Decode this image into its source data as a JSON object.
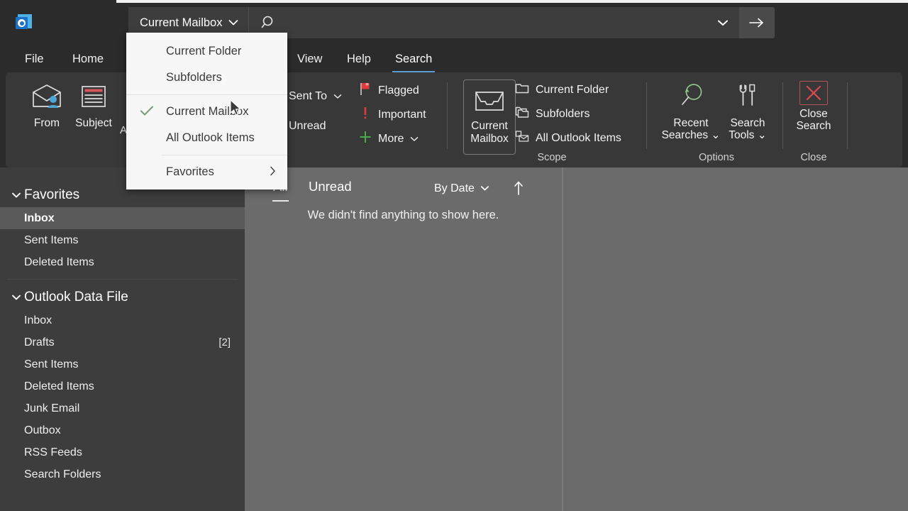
{
  "app": {
    "name": "Microsoft Outlook",
    "logo_icon": "outlook-logo-icon"
  },
  "search": {
    "scope_label": "Current Mailbox",
    "scope_chevron_icon": "chevron-down-icon",
    "search_icon": "magnifier-icon",
    "input_value": "",
    "input_placeholder": "",
    "expand_icon": "chevron-down-icon",
    "submit_icon": "arrow-right-icon"
  },
  "ribbon_tabs": [
    {
      "label": "File",
      "active": false
    },
    {
      "label": "Home",
      "active": false
    },
    {
      "label": "View",
      "active": false
    },
    {
      "label": "Help",
      "active": false
    },
    {
      "label": "Search",
      "active": true
    }
  ],
  "ribbon": {
    "scope_group_label": "Scope",
    "options_group_label": "Options",
    "close_group_label": "Close",
    "refine_buttons": [
      {
        "label": "From",
        "icon": "envelope-person-icon"
      },
      {
        "label": "Subject",
        "icon": "subject-lines-icon"
      }
    ],
    "partial_label": "At",
    "refine_small": [
      {
        "label": "Sent To",
        "has_chevron": true,
        "icon": "chevron-down-icon"
      },
      {
        "label": "Unread",
        "has_chevron": false,
        "icon": ""
      }
    ],
    "flag_items": [
      {
        "label": "Flagged",
        "icon": "red-flag-icon",
        "color": "#e03a3a"
      },
      {
        "label": "Important",
        "icon": "exclamation-icon",
        "color": "#e03a3a"
      },
      {
        "label": "More",
        "icon": "green-plus-icon",
        "color": "#4caf50",
        "has_chevron": true
      }
    ],
    "scope_primary": {
      "label_line1": "Current",
      "label_line2": "Mailbox",
      "icon": "mailbox-tray-icon",
      "selected": true
    },
    "scope_items": [
      {
        "label": "Current Folder",
        "icon": "folder-icon"
      },
      {
        "label": "Subfolders",
        "icon": "folders-stacked-icon"
      },
      {
        "label": "All Outlook Items",
        "icon": "all-items-icon"
      }
    ],
    "options_buttons": [
      {
        "label_line1": "Recent",
        "label_line2": "Searches",
        "icon": "recent-search-icon",
        "has_chevron": true
      },
      {
        "label_line1": "Search",
        "label_line2": "Tools",
        "icon": "wrench-screwdriver-icon",
        "has_chevron": true
      }
    ],
    "close_button": {
      "label_line1": "Close",
      "label_line2": "Search",
      "icon": "red-x-icon",
      "color": "#d94a52"
    }
  },
  "scope_menu": {
    "open": true,
    "items": [
      {
        "label": "Current Folder",
        "checked": false,
        "submenu": false
      },
      {
        "label": "Subfolders",
        "checked": false,
        "submenu": false
      },
      {
        "label": "Current Mailbox",
        "checked": true,
        "submenu": false
      },
      {
        "label": "All Outlook Items",
        "checked": false,
        "submenu": false
      },
      {
        "label": "Favorites",
        "checked": false,
        "submenu": true
      }
    ],
    "check_icon": "checkmark-icon",
    "submenu_icon": "chevron-right-icon"
  },
  "sidebar": {
    "collapse_icon": "chevron-left-icon",
    "groups": [
      {
        "title": "Favorites",
        "chevron_icon": "chevron-down-icon",
        "items": [
          {
            "label": "Inbox",
            "count": "",
            "selected": true
          },
          {
            "label": "Sent Items",
            "count": "",
            "selected": false
          },
          {
            "label": "Deleted Items",
            "count": "",
            "selected": false
          }
        ]
      },
      {
        "title": "Outlook Data File",
        "chevron_icon": "chevron-down-icon",
        "items": [
          {
            "label": "Inbox",
            "count": "",
            "selected": false
          },
          {
            "label": "Drafts",
            "count": "[2]",
            "selected": false
          },
          {
            "label": "Sent Items",
            "count": "",
            "selected": false
          },
          {
            "label": "Deleted Items",
            "count": "",
            "selected": false
          },
          {
            "label": "Junk Email",
            "count": "",
            "selected": false
          },
          {
            "label": "Outbox",
            "count": "",
            "selected": false
          },
          {
            "label": "RSS Feeds",
            "count": "",
            "selected": false
          },
          {
            "label": "Search Folders",
            "count": "",
            "selected": false
          }
        ]
      }
    ]
  },
  "message_list": {
    "filters": [
      {
        "label": "All",
        "active": true
      },
      {
        "label": "Unread",
        "active": false
      }
    ],
    "sort_label": "By Date",
    "sort_chevron_icon": "chevron-down-icon",
    "sort_direction_icon": "arrow-up-icon",
    "empty_text": "We didn't find anything to show here."
  },
  "colors": {
    "window_bg": "#2b2b2b",
    "ribbon_bg": "#383838",
    "sidebar_bg": "#3d3d3d",
    "content_bg": "#6b6b6b",
    "menu_bg": "#f7f7f7",
    "accent": "#5b9bd5",
    "selected_row": "#5a5a5a",
    "flag_red": "#e03a3a",
    "plus_green": "#4caf50",
    "close_red": "#d94a52"
  }
}
